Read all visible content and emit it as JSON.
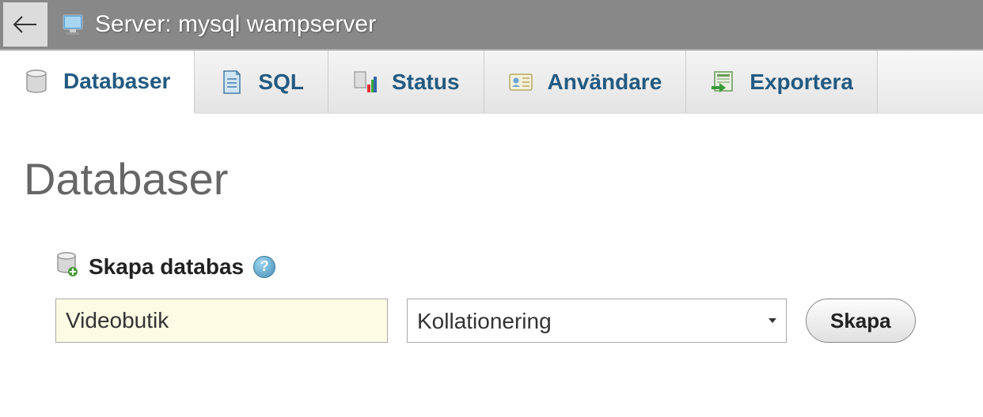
{
  "header": {
    "server_label": "Server: mysql wampserver"
  },
  "tabs": [
    {
      "label": "Databaser",
      "icon": "database-icon",
      "active": true
    },
    {
      "label": "SQL",
      "icon": "sql-icon",
      "active": false
    },
    {
      "label": "Status",
      "icon": "status-icon",
      "active": false
    },
    {
      "label": "Användare",
      "icon": "users-icon",
      "active": false
    },
    {
      "label": "Exportera",
      "icon": "export-icon",
      "active": false
    }
  ],
  "main": {
    "heading": "Databaser",
    "create": {
      "section_label": "Skapa databas",
      "help_glyph": "?",
      "db_name_value": "Videobutik",
      "collation_selected": "Kollationering",
      "submit_label": "Skapa"
    }
  }
}
